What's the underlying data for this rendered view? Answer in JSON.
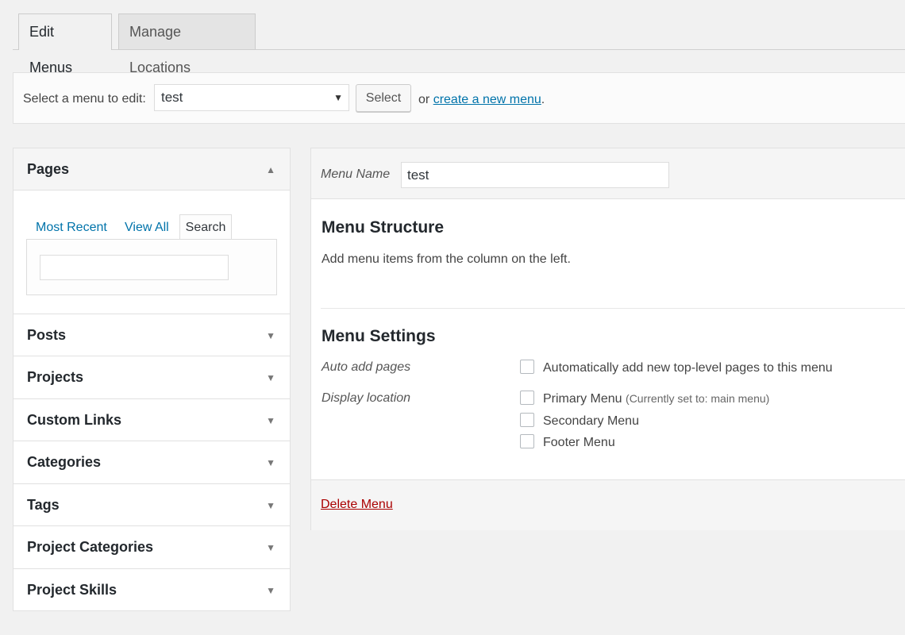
{
  "tabs": [
    {
      "label": "Edit Menus",
      "active": true
    },
    {
      "label": "Manage Locations",
      "active": false
    }
  ],
  "select_bar": {
    "label": "Select a menu to edit:",
    "selected_menu": "test",
    "select_button": "Select",
    "or_text": "or",
    "create_link": "create a new menu",
    "period": "."
  },
  "accordion": {
    "pages": {
      "title": "Pages",
      "tabs": [
        "Most Recent",
        "View All",
        "Search"
      ],
      "active_tab": "Search",
      "search_value": ""
    },
    "sections": [
      "Posts",
      "Projects",
      "Custom Links",
      "Categories",
      "Tags",
      "Project Categories",
      "Project Skills"
    ]
  },
  "menu_edit": {
    "name_label": "Menu Name",
    "name_value": "test",
    "structure_title": "Menu Structure",
    "structure_desc": "Add menu items from the column on the left.",
    "settings_title": "Menu Settings",
    "auto_add_label": "Auto add pages",
    "auto_add_option": "Automatically add new top-level pages to this menu",
    "display_location_label": "Display location",
    "locations": [
      {
        "label": "Primary Menu",
        "note": "(Currently set to: main menu)",
        "checked": false
      },
      {
        "label": "Secondary Menu",
        "note": "",
        "checked": false
      },
      {
        "label": "Footer Menu",
        "note": "",
        "checked": false
      }
    ],
    "delete_link": "Delete Menu"
  },
  "colors": {
    "link": "#0073aa",
    "delete": "#a00000",
    "background": "#f1f1f1"
  }
}
